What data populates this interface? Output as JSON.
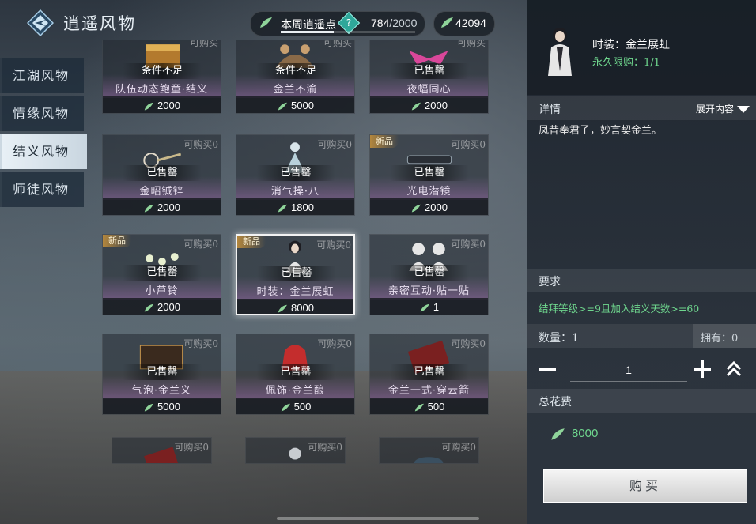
{
  "header": {
    "title": "逍遥风物",
    "points_label": "本周逍遥点",
    "help_symbol": "?",
    "points_current": "784",
    "points_max": "/2000",
    "points_progress": 0.392,
    "currency": "42094"
  },
  "nav": [
    {
      "label": "江湖风物",
      "active": false
    },
    {
      "label": "情缘风物",
      "active": false
    },
    {
      "label": "结义风物",
      "active": true
    },
    {
      "label": "师徒风物",
      "active": false
    }
  ],
  "cards": [
    {
      "name": "队伍动态鲍童·结义",
      "status": "条件不足",
      "price": "2000",
      "limit": "可购买",
      "new": false,
      "art": "box-gold"
    },
    {
      "name": "金兰不渝",
      "status": "条件不足",
      "price": "5000",
      "limit": "可购买",
      "new": false,
      "art": "dance"
    },
    {
      "name": "夜蝠同心",
      "status": "已售罄",
      "price": "2000",
      "limit": "可购买",
      "new": false,
      "art": "bat-pink"
    },
    {
      "name": "金昭铖锌",
      "status": "已售罄",
      "price": "2000",
      "limit": "可购买0",
      "new": false,
      "art": "mirror"
    },
    {
      "name": "消气操·八",
      "status": "已售罄",
      "price": "1800",
      "limit": "可购买0",
      "new": false,
      "art": "figure-teal"
    },
    {
      "name": "光电潜镜",
      "status": "已售罄",
      "price": "2000",
      "limit": "可购买0",
      "new": true,
      "art": "glasses"
    },
    {
      "name": "小芦铃",
      "status": "已售罄",
      "price": "2000",
      "limit": "可购买0",
      "new": true,
      "art": "bells"
    },
    {
      "name": "时装：金兰展虹",
      "status": "已售罄",
      "price": "8000",
      "limit": "可购买0",
      "new": true,
      "art": "portrait"
    },
    {
      "name": "亲密互动·贴一贴",
      "status": "已售罄",
      "price": "1",
      "limit": "可购买0",
      "new": false,
      "art": "silhouettes"
    },
    {
      "name": "气泡·金兰义",
      "status": "已售罄",
      "price": "5000",
      "limit": "可购买0",
      "new": false,
      "art": "bubble"
    },
    {
      "name": "佩饰·金兰酿",
      "status": "已售罄",
      "price": "500",
      "limit": "可购买0",
      "new": false,
      "art": "red-pack"
    },
    {
      "name": "金兰一式·穿云箭",
      "status": "已售罄",
      "price": "500",
      "limit": "可购买0",
      "new": false,
      "art": "book"
    },
    {
      "name": "",
      "status": "",
      "price": "",
      "limit": "可购买0",
      "new": false,
      "art": "book"
    },
    {
      "name": "",
      "status": "",
      "price": "",
      "limit": "可购买0",
      "new": false,
      "art": "figure-gray"
    },
    {
      "name": "",
      "status": "",
      "price": "",
      "limit": "可购买0",
      "new": false,
      "art": "bowl"
    }
  ],
  "new_tag": "新品",
  "detail": {
    "item_title": "时装：金兰展虹",
    "limit_text": "永久限购：1/1",
    "details_label": "详情",
    "expand_label": "展开内容",
    "description": "凤昔奉君子，妙言契金兰。",
    "requirement_label": "要求",
    "requirement_text": "结拜等级>=9且加入结义天数>=60",
    "quantity_label": "数量：1",
    "owned_label": "拥有：0",
    "quantity_value": "1",
    "total_label": "总花费",
    "total_value": "8000",
    "buy_label": "购买"
  },
  "colors": {
    "accent_green": "#6fd78e",
    "leaf": "#8fd49a"
  }
}
